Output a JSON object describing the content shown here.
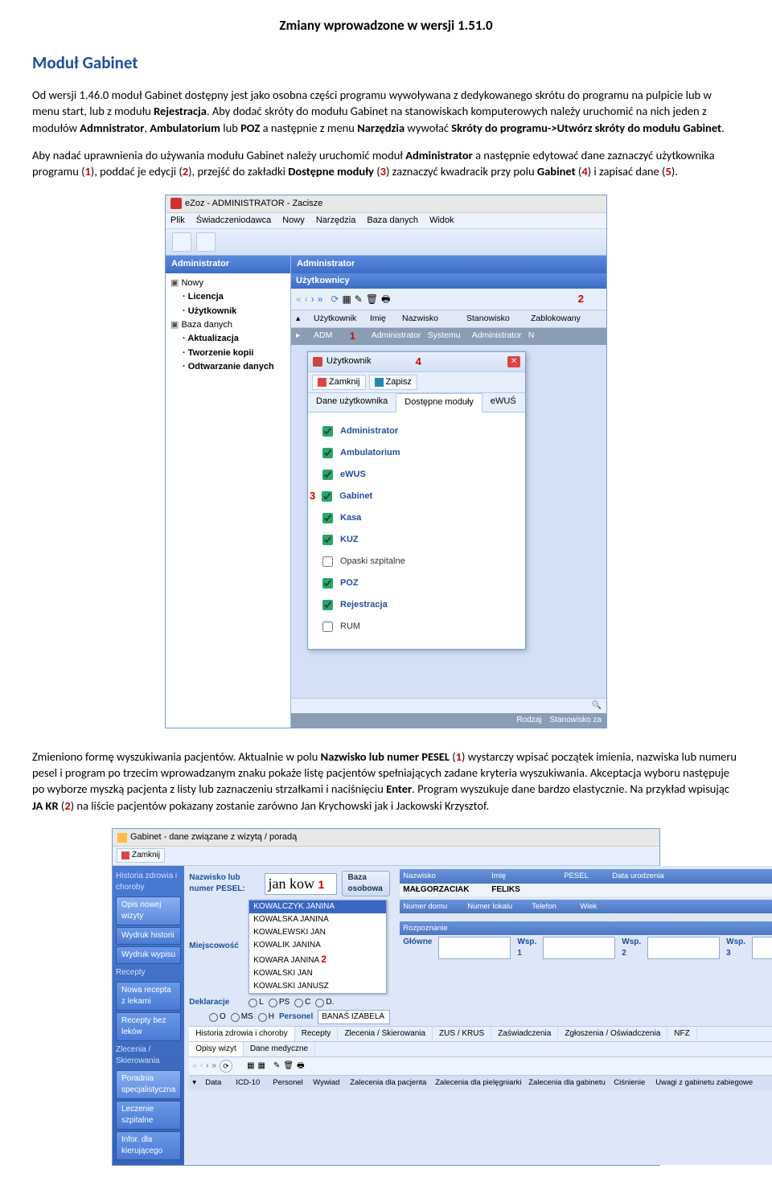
{
  "doc": {
    "title": "Zmiany wprowadzone w wersji 1.51.0",
    "section": "Moduł Gabinet",
    "p1a": "Od wersji 1.46.0 moduł Gabinet dostępny jest jako osobna części programu wywoływana z dedykowanego skrótu do programu na pulpicie lub w menu start, lub z modułu ",
    "p1b": "Rejestracja",
    "p1c": ". Aby dodać skróty do modułu Gabinet na stanowiskach komputerowych należy uruchomić na nich jeden z modułów ",
    "p1d": "Admnistrator",
    "p1e": ", ",
    "p1f": "Ambulatorium",
    "p1g": " lub ",
    "p1h": "POZ",
    "p1i": " a następnie z menu ",
    "p1j": "Narzędzia",
    "p1k": " wywołać ",
    "p1l": "Skróty do programu->Utwórz skróty do modułu Gabinet",
    "p1m": ".",
    "p2a": "Aby nadać uprawnienia do używania modułu Gabinet należy uruchomić moduł ",
    "p2b": "Administrator",
    "p2c": " a następnie edytować dane zaznaczyć użytkownika programu (",
    "p2d": "1",
    "p2e": "), poddać je edycji (",
    "p2f": "2",
    "p2g": "), przejść do zakładki ",
    "p2h": "Dostępne moduły",
    "p2i": " (",
    "p2j": "3",
    "p2k": ") zaznaczyć kwadracik przy polu ",
    "p2l": "Gabinet",
    "p2m": " (",
    "p2n": "4",
    "p2o": ") i zapisać dane (",
    "p2p": "5",
    "p2q": ").",
    "p3a": "Zmieniono formę wyszukiwania pacjentów. Aktualnie w polu ",
    "p3b": "Nazwisko lub numer PESEL",
    "p3c": " (",
    "p3d": "1",
    "p3e": ") wystarczy wpisać początek imienia, nazwiska lub numeru pesel i program po trzecim wprowadzanym znaku pokaże listę pacjentów spełniających zadane kryteria wyszukiwania. Akceptacja wyboru następuje po wyborze myszką pacjenta z listy lub zaznaczeniu strzałkami i naciśnięciu ",
    "p3f": "Enter",
    "p3g": ". Program wyszukuje dane bardzo elastycznie. Na przykład wpisując ",
    "p3h": "JA KR",
    "p3i": " (",
    "p3j": "2",
    "p3k": ") na liście pacjentów pokazany zostanie zarówno Jan Krychowski jak i Jackowski Krzysztof."
  },
  "s1": {
    "wintitle": "eZoz - ADMINISTRATOR - Zacisze",
    "menu": [
      "Plik",
      "Świadczeniodawca",
      "Nowy",
      "Narzędzia",
      "Baza danych",
      "Widok"
    ],
    "side_hdr": "Administrator",
    "tree": {
      "g1": "Nowy",
      "g1a": "Licencja",
      "g1b": "Użytkownik",
      "g2": "Baza danych",
      "g2a": "Aktualizacja",
      "g2b": "Tworzenie kopii",
      "g2c": "Odtwarzanie danych"
    },
    "main_hdr": "Administrator",
    "sub_hdr": "Użytkownicy",
    "gridcols": [
      "Użytkownik",
      "Imię",
      "Nazwisko",
      "Stanowisko",
      "Zablokowany"
    ],
    "gridrow": [
      "ADM",
      "",
      "Administrator",
      "Systemu",
      "Administrator",
      "N"
    ],
    "ref1": "1",
    "ref2": "2",
    "dlg_title": "Użytkownik",
    "ref4": "4",
    "btn_close": "Zamknij",
    "btn_save": "Zapisz",
    "tabs": [
      "Dane użytkownika",
      "Dostępne moduły",
      "eWUŚ"
    ],
    "ref3": "3",
    "modules": [
      {
        "label": "Administrator",
        "checked": true
      },
      {
        "label": "Ambulatorium",
        "checked": true
      },
      {
        "label": "eWUS",
        "checked": true
      },
      {
        "label": "Gabinet",
        "checked": true
      },
      {
        "label": "Kasa",
        "checked": true
      },
      {
        "label": "KUZ",
        "checked": true
      },
      {
        "label": "Opaski szpitalne",
        "checked": false
      },
      {
        "label": "POZ",
        "checked": true
      },
      {
        "label": "Rejestracja",
        "checked": true
      },
      {
        "label": "RUM",
        "checked": false
      }
    ],
    "footer_cols": [
      "Rodzaj",
      "Stanowisko za"
    ]
  },
  "s2": {
    "wintitle": "Gabinet - dane związane z wizytą / poradą",
    "close": "Zamknij",
    "side": {
      "g1": "Historia zdrowia i choroby",
      "b1": "Opis nowej wizyty",
      "b2": "Wydruk historii",
      "b3": "Wydruk wypisu",
      "g2": "Recepty",
      "b4": "Nowa recepta z lekami",
      "b5": "Recepty bez leków",
      "g3": "Zlecenia / Skierowania",
      "b6": "Poradnia specjalistyczna",
      "b7": "Leczenie szpitalne",
      "b8": "Infor. dla kierującego"
    },
    "lbl_nazw": "Nazwisko lub numer PESEL:",
    "input_val": "jan kow",
    "ref1": "1",
    "pill_baza": "Baza osobowa",
    "lbl_miejsc": "Miejscowość",
    "lbl_dekl": "Deklaracje",
    "radios": [
      "L",
      "PS",
      "C",
      "D."
    ],
    "radios2": [
      "O",
      "MS",
      "H"
    ],
    "lbl_personel": "Personel",
    "personel_val": "BANAŚ IZABELA",
    "dropdown": [
      "KOWALCZYK JANINA",
      "KOWALSKA JANINA",
      "KOWALEWSKI JAN",
      "KOWALIK JANINA",
      "KOWARA JANINA",
      "KOWALSKI JAN",
      "KOWALSKI JANUSZ"
    ],
    "ref2": "2",
    "res": {
      "nazw": "Nazwisko",
      "nazw_v": "MAŁGORZACIAK",
      "imie": "Imię",
      "imie_v": "FELIKS",
      "pesel": "PESEL",
      "data": "Data urodzenia",
      "nrdomu": "Numer domu",
      "nrlok": "Numer lokalu",
      "tel": "Telefon",
      "wiek": "Wiek",
      "rozp": "Rozpoznanie",
      "glowne": "Główne",
      "wsp1": "Wsp. 1",
      "wsp2": "Wsp. 2",
      "wsp3": "Wsp. 3"
    },
    "tabs1": [
      "Historia zdrowia i choroby",
      "Recepty",
      "Zlecenia / Skierowania",
      "ZUS / KRUS",
      "Zaświadczenia",
      "Zgłoszenia / Oświadczenia",
      "NFZ"
    ],
    "tabs2": [
      "Opisy wizyt",
      "Dane medyczne"
    ],
    "cols": [
      "Data",
      "ICD-10",
      "Personel",
      "Wywiad",
      "Zalecenia dla pacjenta",
      "Zalecenia dla pielęgniarki",
      "Zalecenia dla gabinetu",
      "Ciśnienie",
      "Uwagi z gabinetu zabiegowe"
    ]
  }
}
